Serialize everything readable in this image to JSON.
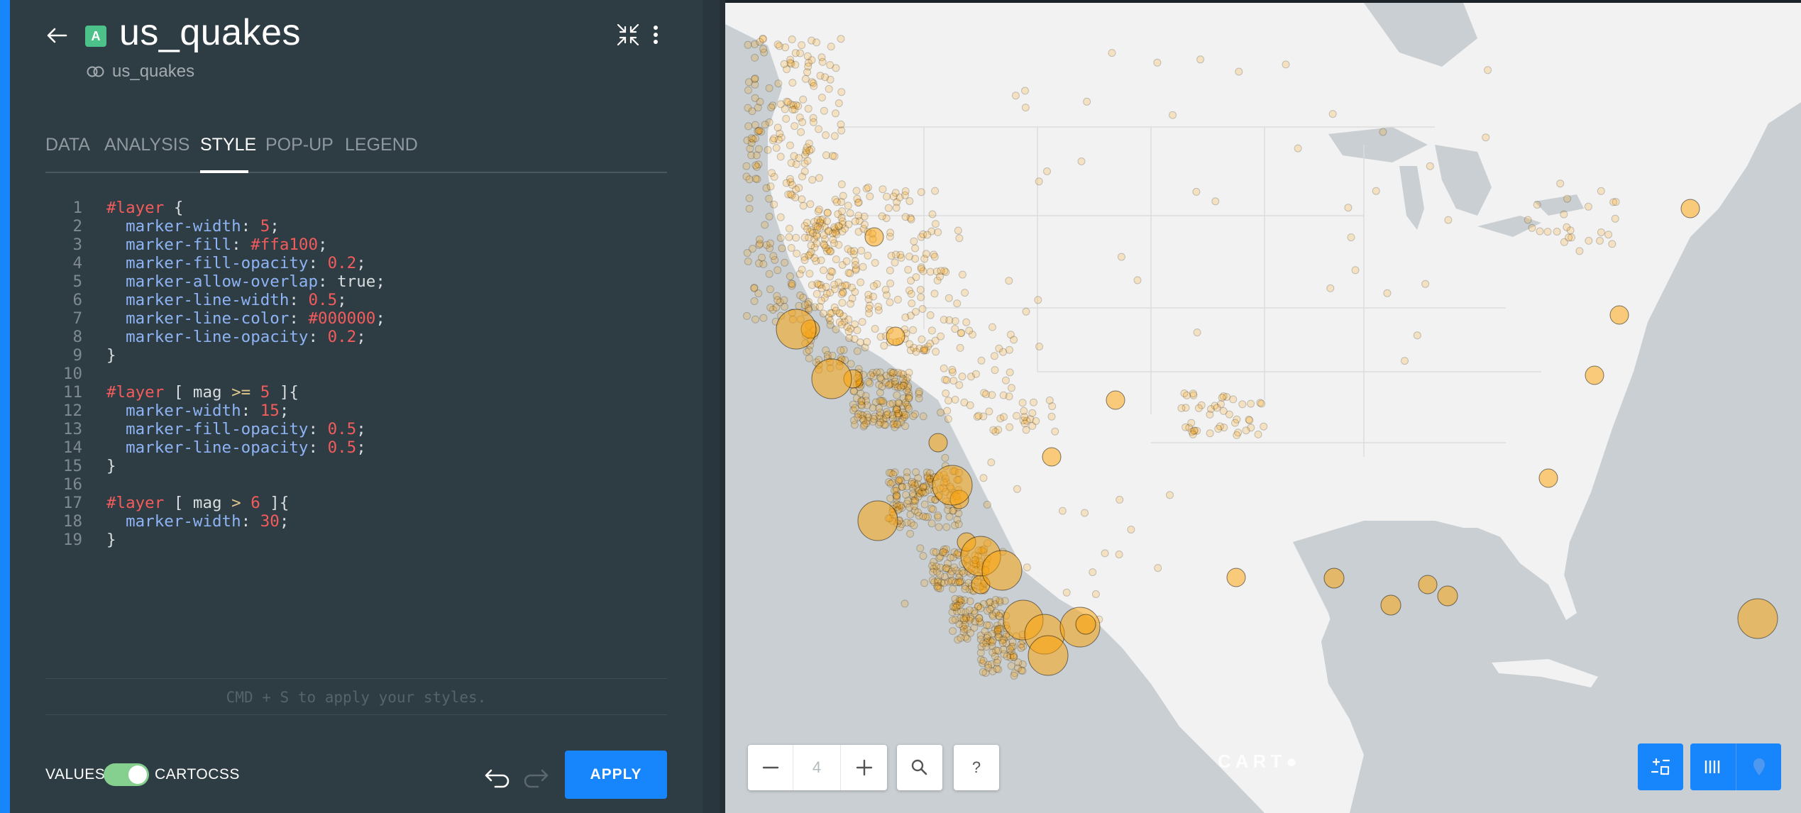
{
  "header": {
    "layer_badge": "A",
    "title": "us_quakes",
    "source_name": "us_quakes"
  },
  "tabs": [
    {
      "label": "DATA"
    },
    {
      "label": "ANALYSIS"
    },
    {
      "label": "STYLE",
      "active": true
    },
    {
      "label": "POP-UP"
    },
    {
      "label": "LEGEND"
    }
  ],
  "editor": {
    "lines": [
      {
        "n": "1",
        "text": "#layer {"
      },
      {
        "n": "2",
        "text": "  marker-width: 5;"
      },
      {
        "n": "3",
        "text": "  marker-fill: #ffa100;"
      },
      {
        "n": "4",
        "text": "  marker-fill-opacity: 0.2;"
      },
      {
        "n": "5",
        "text": "  marker-allow-overlap: true;"
      },
      {
        "n": "6",
        "text": "  marker-line-width: 0.5;"
      },
      {
        "n": "7",
        "text": "  marker-line-color: #000000;"
      },
      {
        "n": "8",
        "text": "  marker-line-opacity: 0.2;"
      },
      {
        "n": "9",
        "text": "}"
      },
      {
        "n": "10",
        "text": ""
      },
      {
        "n": "11",
        "text": "#layer [ mag >= 5 ]{"
      },
      {
        "n": "12",
        "text": "  marker-width: 15;"
      },
      {
        "n": "13",
        "text": "  marker-fill-opacity: 0.5;"
      },
      {
        "n": "14",
        "text": "  marker-line-opacity: 0.5;"
      },
      {
        "n": "15",
        "text": "}"
      },
      {
        "n": "16",
        "text": ""
      },
      {
        "n": "17",
        "text": "#layer [ mag > 6 ]{"
      },
      {
        "n": "18",
        "text": "  marker-width: 30;"
      },
      {
        "n": "19",
        "text": "}"
      }
    ],
    "hint": "CMD + S to apply your styles."
  },
  "footer": {
    "values_label": "VALUES",
    "cartocss_label": "CARTOCSS",
    "toggle_on": true,
    "apply_label": "APPLY"
  },
  "map": {
    "zoom_level": "4",
    "help_label": "?",
    "attribution_logo": "CART●",
    "marker_fill": "#ffa100",
    "land_color": "#f2f2f2",
    "water_color": "#c9cfd2"
  },
  "colors": {
    "accent": "#1785fb",
    "panel": "#2e3c43",
    "toggle": "#85d08e"
  }
}
